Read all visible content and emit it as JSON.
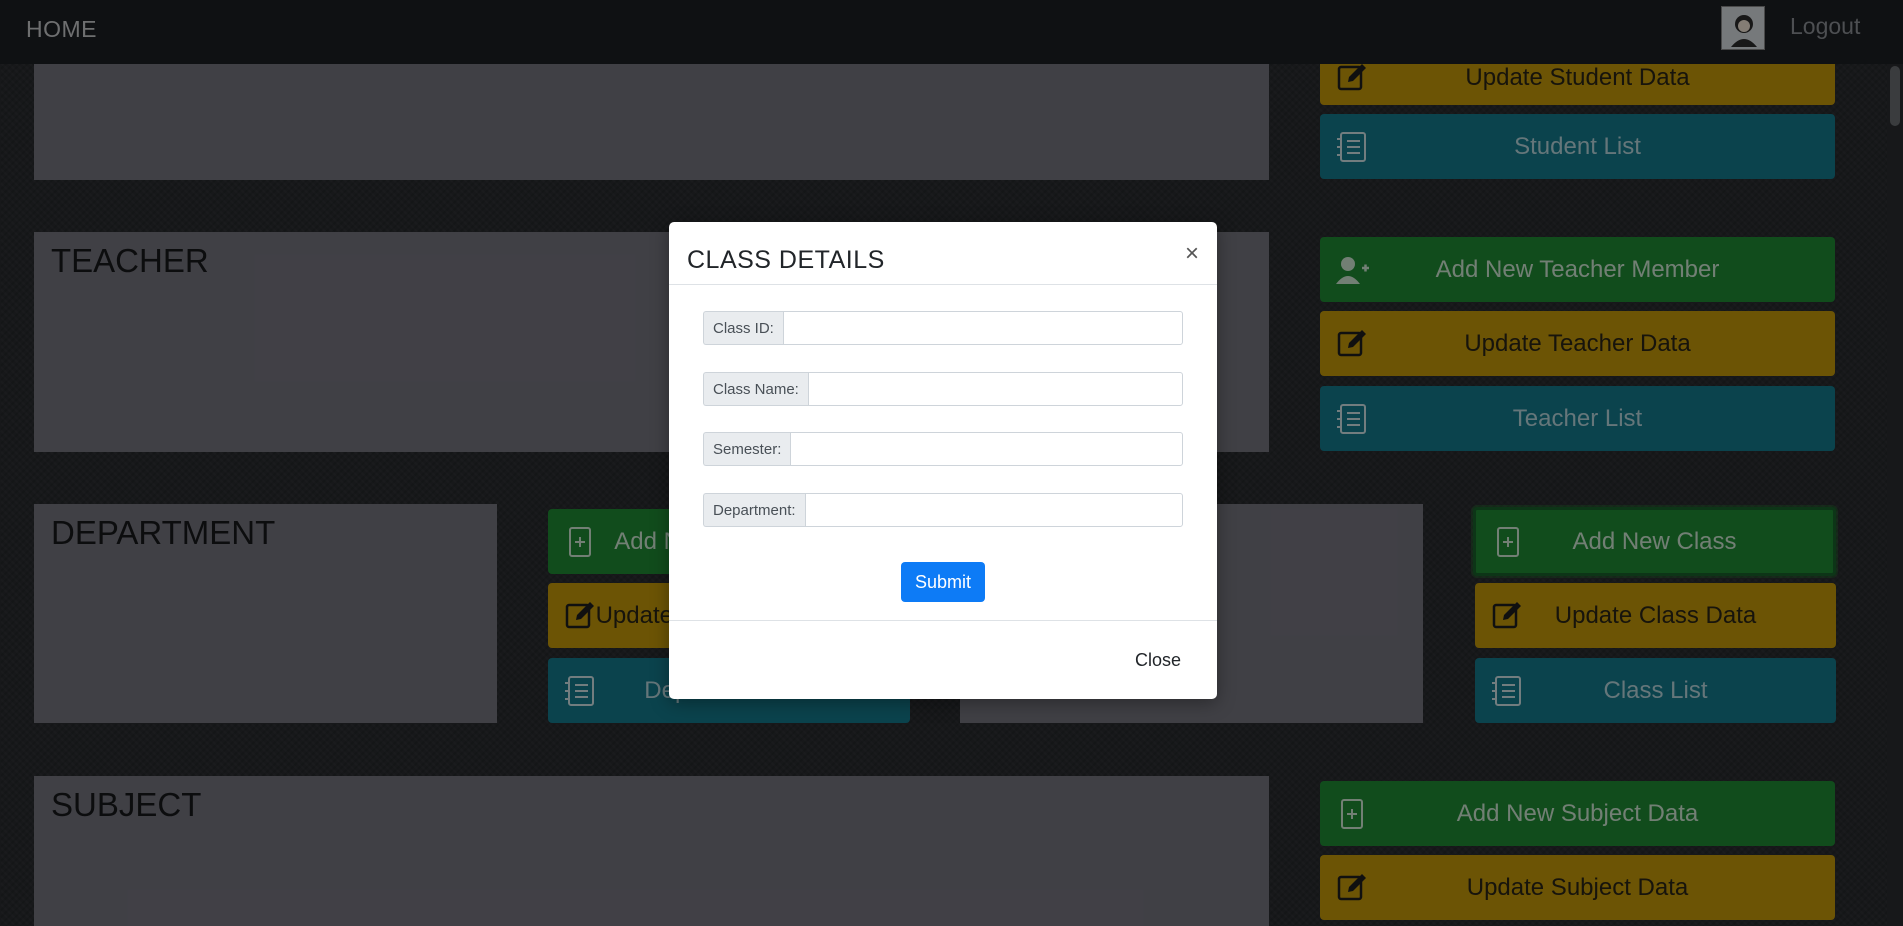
{
  "navbar": {
    "home": "HOME",
    "logout": "Logout"
  },
  "sections": {
    "student": {
      "title": ""
    },
    "teacher": {
      "title": "TEACHER"
    },
    "department": {
      "title": "DEPARTMENT"
    },
    "class": {
      "title": ""
    },
    "subject": {
      "title": "SUBJECT"
    }
  },
  "buttons": {
    "update_student": "Update Student Data",
    "student_list": "Student List",
    "add_teacher": "Add New Teacher Member",
    "update_teacher": "Update Teacher Data",
    "teacher_list": "Teacher List",
    "add_department": "Add New Department",
    "update_department": "Update Department Data",
    "department_list": "Department List",
    "add_class": "Add New Class",
    "update_class": "Update Class Data",
    "class_list": "Class List",
    "add_subject": "Add New Subject Data",
    "update_subject": "Update Subject Data"
  },
  "modal": {
    "title": "CLASS DETAILS",
    "close_symbol": "×",
    "fields": [
      {
        "label": "Class ID:",
        "value": ""
      },
      {
        "label": "Class Name:",
        "value": ""
      },
      {
        "label": "Semester:",
        "value": ""
      },
      {
        "label": "Department:",
        "value": ""
      }
    ],
    "submit": "Submit",
    "close": "Close"
  },
  "colors": {
    "green": "#1f8a34",
    "yellow": "#c59a0a",
    "cyan": "#147a8c",
    "primary": "#0d7bf6"
  },
  "icons": {
    "add": "plus-square-icon",
    "edit": "pencil-square-icon",
    "list": "notebook-list-icon",
    "person": "person-plus-icon"
  }
}
